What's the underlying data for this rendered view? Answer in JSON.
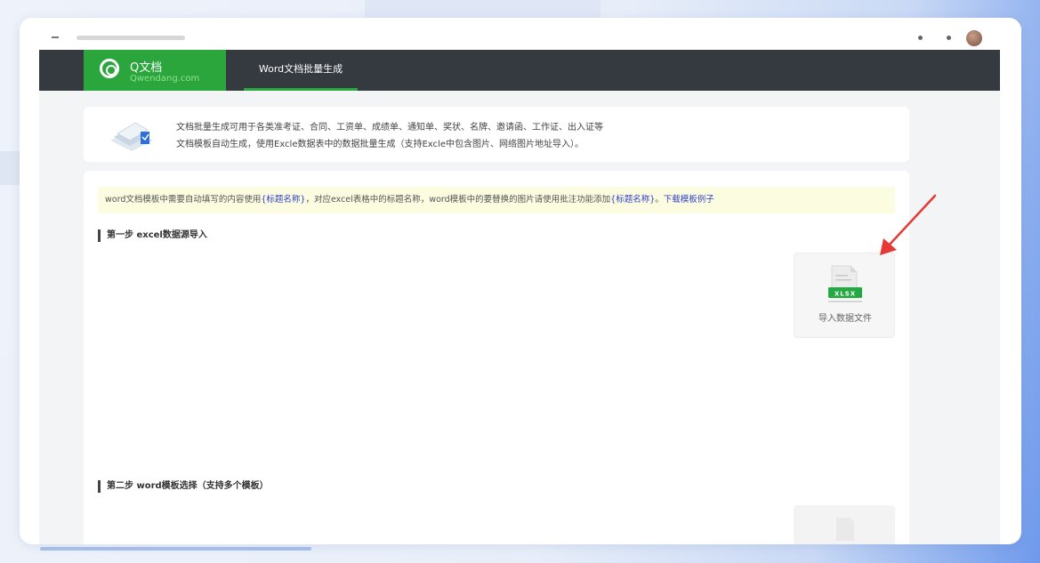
{
  "app": {
    "logo_title": "Q文档",
    "logo_subtitle": "Qwendang.com",
    "nav_tab": "Word文档批量生成"
  },
  "info": {
    "line1": "文档批量生成可用于各类准考证、合同、工资单、成绩单、通知单、奖状、名牌、邀请函、工作证、出入证等",
    "line2": "文档模板自动生成，使用Excle数据表中的数据批量生成（支持Excle中包含图片、网络图片地址导入）。"
  },
  "notice": {
    "part1": "word文档模板中需要自动填写的内容使用",
    "tag1": "{标题名称}",
    "part2": "，对应excel表格中的标题名称，word模板中的要替换的图片请使用批注功能添加",
    "tag2": "{标题名称}",
    "part3": "。",
    "download_link": "下载模板例子"
  },
  "steps": {
    "step1": "第一步 excel数据源导入",
    "step2": "第二步 word模板选择（支持多个模板）"
  },
  "import": {
    "badge": "XLSX",
    "label": "导入数据文件"
  },
  "colors": {
    "brand_green": "#2aa63d",
    "nav_dark": "#343a40",
    "link_blue": "#2f3fc9",
    "notice_bg": "#fcfce0",
    "arrow_red": "#e53935"
  }
}
